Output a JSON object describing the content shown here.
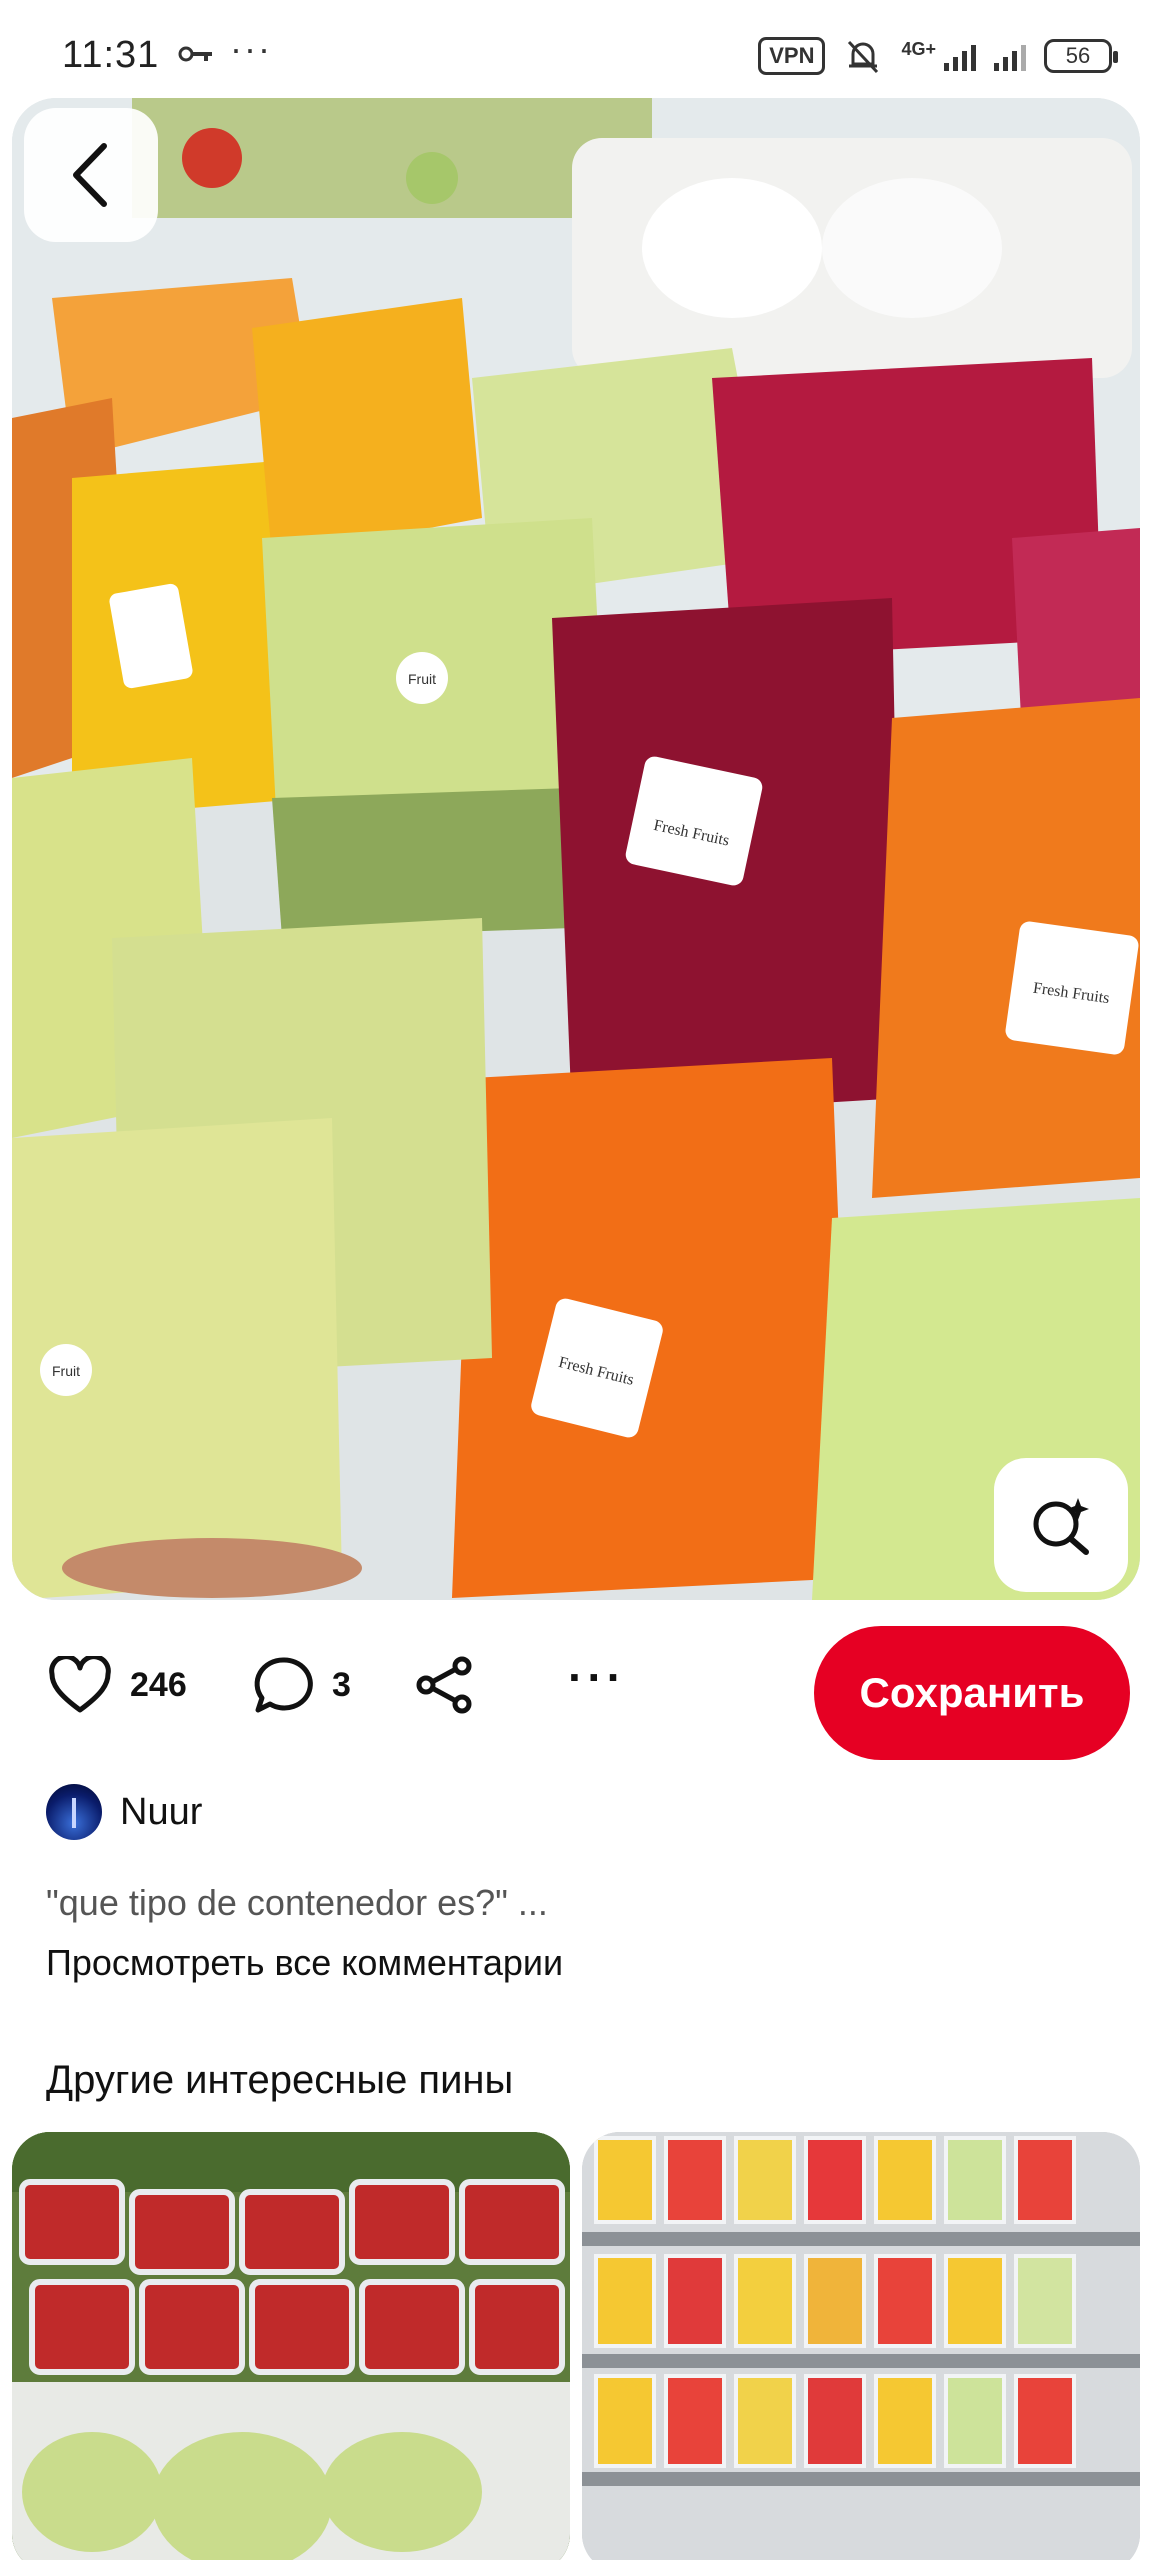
{
  "status_bar": {
    "time": "11:31",
    "dots": "···",
    "vpn": "VPN",
    "network": "4G+",
    "battery": "56",
    "icons": [
      "key-icon",
      "mute-bell-icon",
      "signal-icon",
      "battery-icon"
    ]
  },
  "pin": {
    "image_description_icon": "fruit-packages-photo",
    "label_brand": "Fresh Fruits",
    "label_small": "Fruit"
  },
  "actions": {
    "likes": "246",
    "comments": "3",
    "more": "···",
    "save_label": "Сохранить"
  },
  "author": {
    "name": "Nuur"
  },
  "comments": {
    "preview": "\"que tipo de contenedor es?\" ...",
    "view_all": "Просмотреть все комментарии"
  },
  "related": {
    "title": "Другие интересные пины"
  },
  "colors": {
    "accent": "#e60023"
  }
}
